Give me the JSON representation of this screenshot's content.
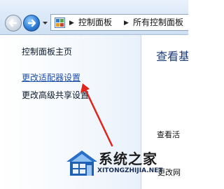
{
  "address_bar": {
    "breadcrumbs": [
      "控制面板",
      "所有控制面板"
    ],
    "icon": "control-panel-icon"
  },
  "nav": {
    "back_icon": "back-arrow-icon",
    "forward_icon": "forward-arrow-icon",
    "dropdown_icon": "chevron-down-icon"
  },
  "left_pane": {
    "items": [
      {
        "label": "控制面板主页"
      },
      {
        "label": "更改适配器设置"
      },
      {
        "label": "更改高级共享设置"
      }
    ]
  },
  "content": {
    "title": "查看基",
    "line1": "查看活",
    "line2": "更改网"
  },
  "annotation": {
    "color": "#e0261c",
    "icon": "red-arrow-annotation"
  },
  "watermark": {
    "title": "系统之家",
    "url": "XITONGZHIJIA.NET"
  }
}
